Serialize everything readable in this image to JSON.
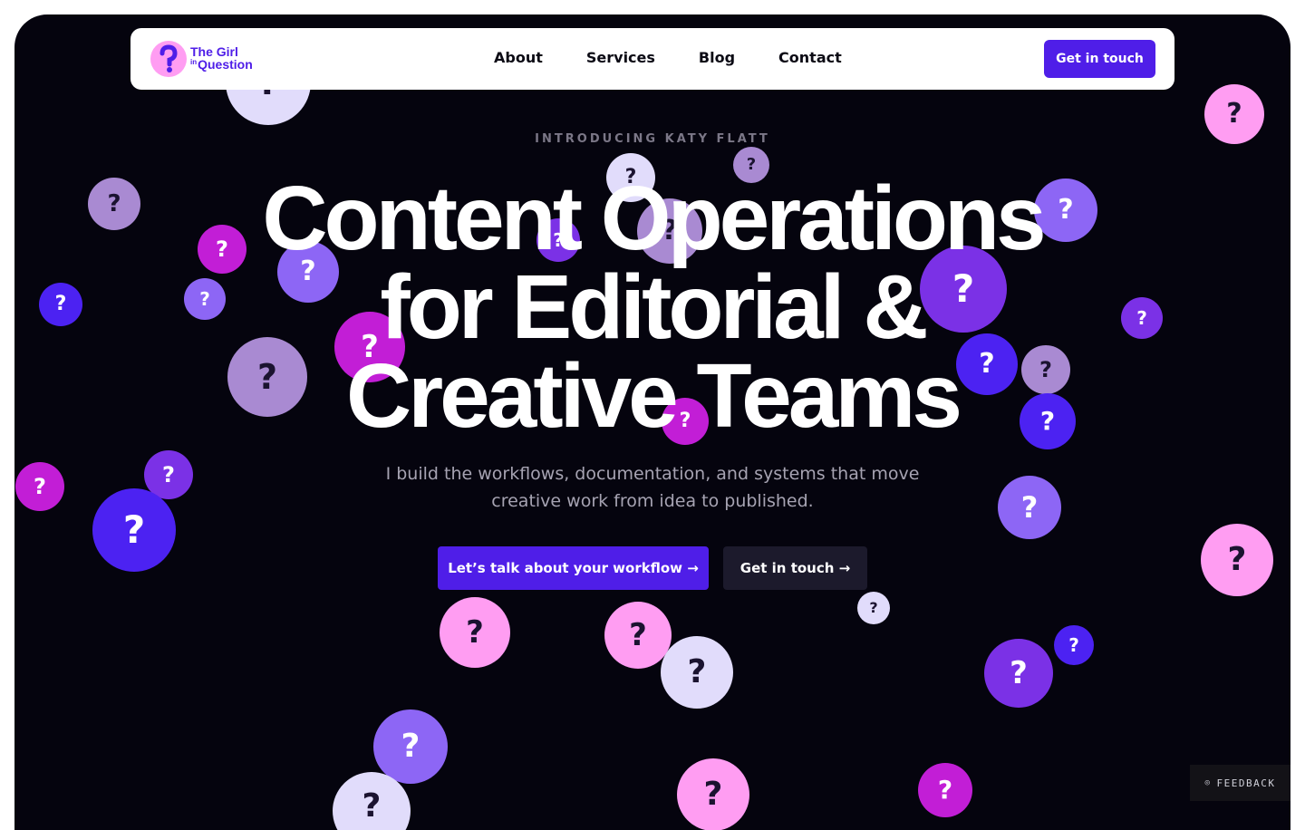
{
  "brand": {
    "line1": "The Girl",
    "in_word": "in",
    "line2": "Question",
    "logo_glyph": "?",
    "logo_icon": "question-mark-logo"
  },
  "nav": {
    "links": [
      "About",
      "Services",
      "Blog",
      "Contact"
    ],
    "cta_label": "Get in touch"
  },
  "hero": {
    "eyebrow": "INTRODUCING KATY FLATT",
    "headline_line1": "Content Operations",
    "headline_line2": "for Editorial &",
    "headline_line3": "Creative Teams",
    "subtext_line1": "I build the workflows, documentation, and systems that move",
    "subtext_line2": "creative work from idea to published.",
    "primary_cta": "Let’s talk about your workflow →",
    "secondary_cta": "Get in touch →"
  },
  "background": {
    "bubble_glyph": "?",
    "bubble_icon": "question-mark-bubble"
  },
  "feedback": {
    "icon": "circle-dot-icon",
    "label": "FEEDBACK"
  },
  "colors": {
    "accent": "#4f1ee8",
    "background": "#05040e",
    "nav_background": "#ffffff",
    "bubble_pink": "#ff9df2",
    "bubble_magenta": "#c21ed6",
    "bubble_lavender": "#a98ad2",
    "bubble_pale": "#e1dcfb",
    "bubble_violet": "#8d66f5",
    "bubble_purple": "#7b31e6",
    "bubble_blue": "#4c22f2"
  }
}
